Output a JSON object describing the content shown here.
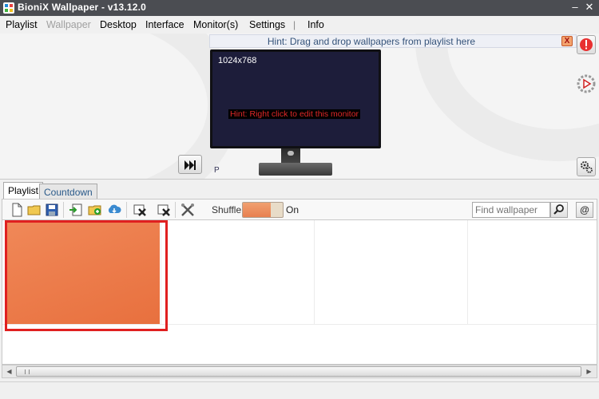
{
  "window": {
    "title": "BioniX Wallpaper -  v13.12.0",
    "minimize": "–",
    "close": "✕"
  },
  "menu": {
    "items": [
      {
        "label": "Playlist",
        "enabled": true
      },
      {
        "label": "Wallpaper",
        "enabled": false
      },
      {
        "label": "Desktop",
        "enabled": true
      },
      {
        "label": "Interface",
        "enabled": true
      },
      {
        "label": "Monitor(s)",
        "enabled": true
      },
      {
        "label": "Settings",
        "enabled": true
      },
      {
        "label": "Info",
        "enabled": true
      }
    ],
    "separator": "|"
  },
  "monitor_panel": {
    "hint": "Hint: Drag and drop wallpapers from playlist here",
    "hint_close": "X",
    "resolution": "1024x768",
    "monitor_hint": "Hint: Right click to edit this monitor",
    "monitor_label": "P"
  },
  "tabs": [
    {
      "label": "Playlist",
      "active": true
    },
    {
      "label": "Countdown",
      "active": false
    }
  ],
  "toolbar": {
    "shuffle_label": "Shuffle",
    "shuffle_state": "On",
    "shuffle_on": true,
    "find_placeholder": "Find wallpaper",
    "at_label": "@"
  },
  "playlist": {
    "items": [
      {
        "selected": true,
        "color": "#ec7b48"
      }
    ]
  },
  "colors": {
    "titlebar": "#4b4d52",
    "accent": "#e02020",
    "thumbnail": "#ec7b48"
  }
}
